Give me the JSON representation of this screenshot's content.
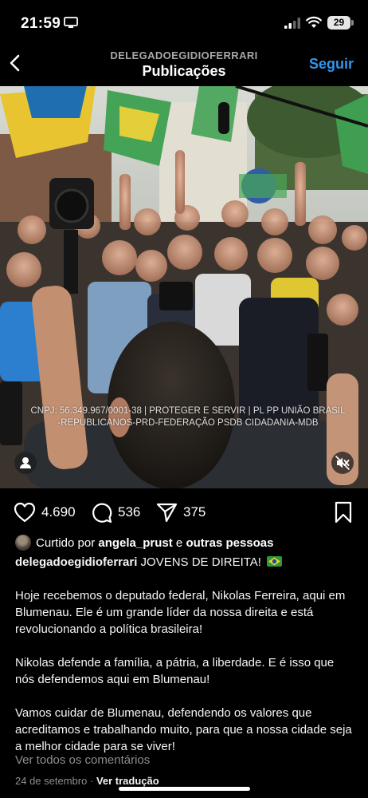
{
  "status": {
    "time": "21:59",
    "battery": "29"
  },
  "header": {
    "account": "DELEGADOEGIDIOFERRARI",
    "title": "Publicações",
    "follow_label": "Seguir"
  },
  "post": {
    "overlay_caption_line1": "CNPJ: 56.349.967/0001-38 | PROTEGER E SERVIR | PL PP UNIÃO BRASIL",
    "overlay_caption_line2": "-REPUBLICANOS-PRD-FEDERAÇÃO PSDB CIDADANIA-MDB",
    "likes_count": "4.690",
    "comments_count": "536",
    "shares_count": "375",
    "liked_by_prefix": "Curtido por",
    "liked_by_user": "angela_prust",
    "liked_by_and": "e",
    "liked_by_others": "outras pessoas",
    "author": "delegadoegidioferrari",
    "headline": "JOVENS DE DIREITA!",
    "paragraphs": [
      "Hoje recebemos o deputado federal, Nikolas Ferreira, aqui em Blumenau. Ele é um grande líder da nossa direita e está revolucionando a política brasileira!",
      "Nikolas defende a família, a pátria, a liberdade. E é isso que nós defendemos aqui em Blumenau!",
      "Vamos cuidar de Blumenau, defendendo os valores que acreditamos e trabalhando muito, para que a nossa cidade seja a melhor cidade para se viver!"
    ],
    "view_comments": "Ver todos os comentários",
    "date": "24 de setembro",
    "separator": "·",
    "translate": "Ver tradução"
  },
  "icons": {
    "back": "chevron-left-icon",
    "like": "heart-icon",
    "comment": "speech-bubble-icon",
    "share": "paper-plane-icon",
    "save": "bookmark-icon",
    "tag": "person-icon",
    "mute": "speaker-muted-icon",
    "flag": "brazil-flag-icon"
  },
  "colors": {
    "accent": "#2e97f0",
    "background": "#000000",
    "muted_text": "#8e8e8e"
  }
}
